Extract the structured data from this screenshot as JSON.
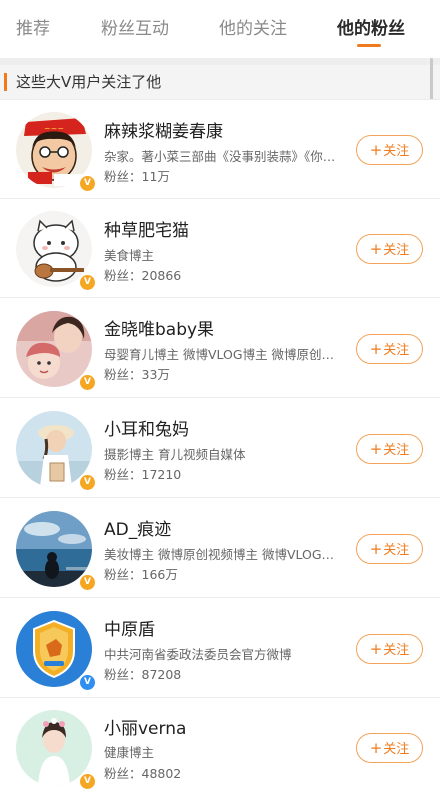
{
  "tabs": [
    {
      "label": "推荐",
      "active": false
    },
    {
      "label": "粉丝互动",
      "active": false
    },
    {
      "label": "他的关注",
      "active": false
    },
    {
      "label": "他的粉丝",
      "active": true
    }
  ],
  "section": {
    "title": "这些大V用户关注了他"
  },
  "follow_label": "关注",
  "colors": {
    "accent": "#f07b1e",
    "verified_gold": "#f5a623",
    "verified_blue": "#2f8ff0"
  },
  "users": [
    {
      "name": "麻辣浆糊姜春康",
      "desc": "杂家。著小菜三部曲《没事别装蒜》《你别吃葱》",
      "fans": "粉丝：11万",
      "verified": "gold",
      "avatar_icon": "caricature-avatar"
    },
    {
      "name": "种草肥宅猫",
      "desc": "美食博主",
      "fans": "粉丝：20866",
      "verified": "gold",
      "avatar_icon": "cat-ukulele-avatar"
    },
    {
      "name": "金晓唯baby果",
      "desc": "母婴育儿博主 微博VLOG博主 微博原创视频博主",
      "fans": "粉丝：33万",
      "verified": "gold",
      "avatar_icon": "mother-baby-avatar"
    },
    {
      "name": "小耳和兔妈",
      "desc": "摄影博主 育儿视频自媒体",
      "fans": "粉丝：17210",
      "verified": "gold",
      "avatar_icon": "girl-hat-avatar"
    },
    {
      "name": "AD_痕迹",
      "desc": "美妆博主 微博原创视频博主 微博VLOG博主",
      "fans": "粉丝：166万",
      "verified": "gold",
      "avatar_icon": "seaside-avatar"
    },
    {
      "name": "中原盾",
      "desc": "中共河南省委政法委员会官方微博",
      "fans": "粉丝：87208",
      "verified": "blue",
      "avatar_icon": "shield-avatar"
    },
    {
      "name": "小丽verna",
      "desc": "健康博主",
      "fans": "粉丝：48802",
      "verified": "gold",
      "avatar_icon": "girl-flowers-avatar"
    }
  ]
}
